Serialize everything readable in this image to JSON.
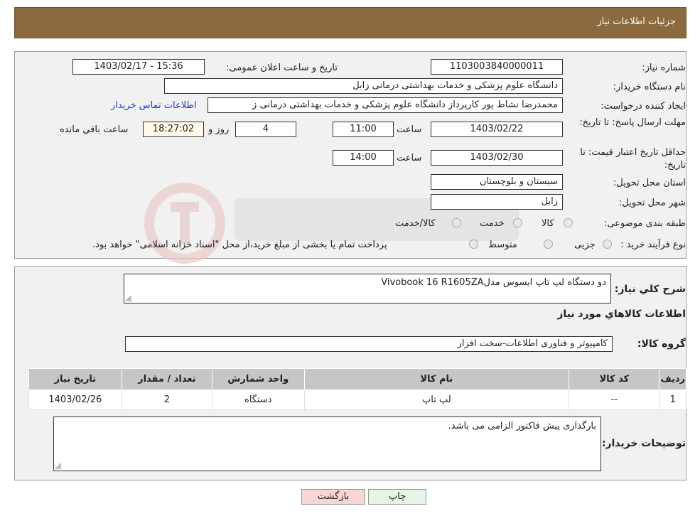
{
  "header": {
    "title": "جزئیات اطلاعات نیاز"
  },
  "form": {
    "need_number_label": "شماره نیاز:",
    "need_number": "1103003840000011",
    "announce_label": "تاریخ و ساعت اعلان عمومی:",
    "announce_value": "1403/02/17 - 15:36",
    "buyer_org_label": "نام دستگاه خریدار:",
    "buyer_org": "دانشگاه علوم پزشکی و خدمات بهداشتی درمانی زابل",
    "requester_label": "ایجاد کننده درخواست:",
    "requester": "محمدرضا  نشاط پور کارپرداز دانشگاه علوم پزشکی و خدمات بهداشتی درمانی ز",
    "contact_link": "اطلاعات تماس خریدار",
    "deadline_label": "مهلت ارسال پاسخ: تا تاریخ:",
    "deadline_date": "1403/02/22",
    "time_label": "ساعت",
    "deadline_time": "11:00",
    "days": "4",
    "days_label": "روز و",
    "remaining_time": "18:27:02",
    "remaining_label": "ساعت باقي مانده",
    "validity_label": "حداقل تاریخ اعتبار قیمت: تا تاریخ:",
    "validity_date": "1403/02/30",
    "validity_time": "14:00",
    "province_label": "استان محل تحویل:",
    "province": "سیستان و بلوچستان",
    "city_label": "شهر محل تحویل:",
    "city": "زابل",
    "category_label": "طبقه بندی موضوعی:",
    "category_options": [
      "کالا",
      "خدمت",
      "کالا/خدمت"
    ],
    "process_label": "نوع فرآیند خرید :",
    "process_options": [
      "جزیی",
      "متوسط"
    ],
    "process_note": "پرداخت تمام یا بخشی از مبلغ خرید،از محل \"اسناد خزانه اسلامی\" خواهد بود."
  },
  "details": {
    "summary_label": "شرح کلي نياز:",
    "summary": "دو دستگاه لپ تاپ ایسوس مدلVivobook 16 R1605ZA",
    "goods_info_title": "اطلاعات کالاهاي مورد نياز",
    "group_label": "گروه کالا:",
    "group_value": "کامپیوتر و فناوری اطلاعات-سخت افزار",
    "table": {
      "headers": [
        "رديف",
        "کد کالا",
        "نام کالا",
        "واحد شمارش",
        "تعداد / مقدار",
        "تاریخ نیاز"
      ],
      "rows": [
        [
          "1",
          "--",
          "لپ تاپ",
          "دستگاه",
          "2",
          "1403/02/26"
        ]
      ]
    },
    "buyer_notes_label": "توضيحات خريدار:",
    "buyer_notes": "بارگذاری پیش فاکتور الزامی می باشد."
  },
  "buttons": {
    "print": "چاپ",
    "back": "بازگشت"
  },
  "colors": {
    "header_bg": "#8b6a3f",
    "link": "#1a3fd1",
    "back_button_bg": "#f8d6d6",
    "print_button_bg": "#e7f3e7"
  }
}
